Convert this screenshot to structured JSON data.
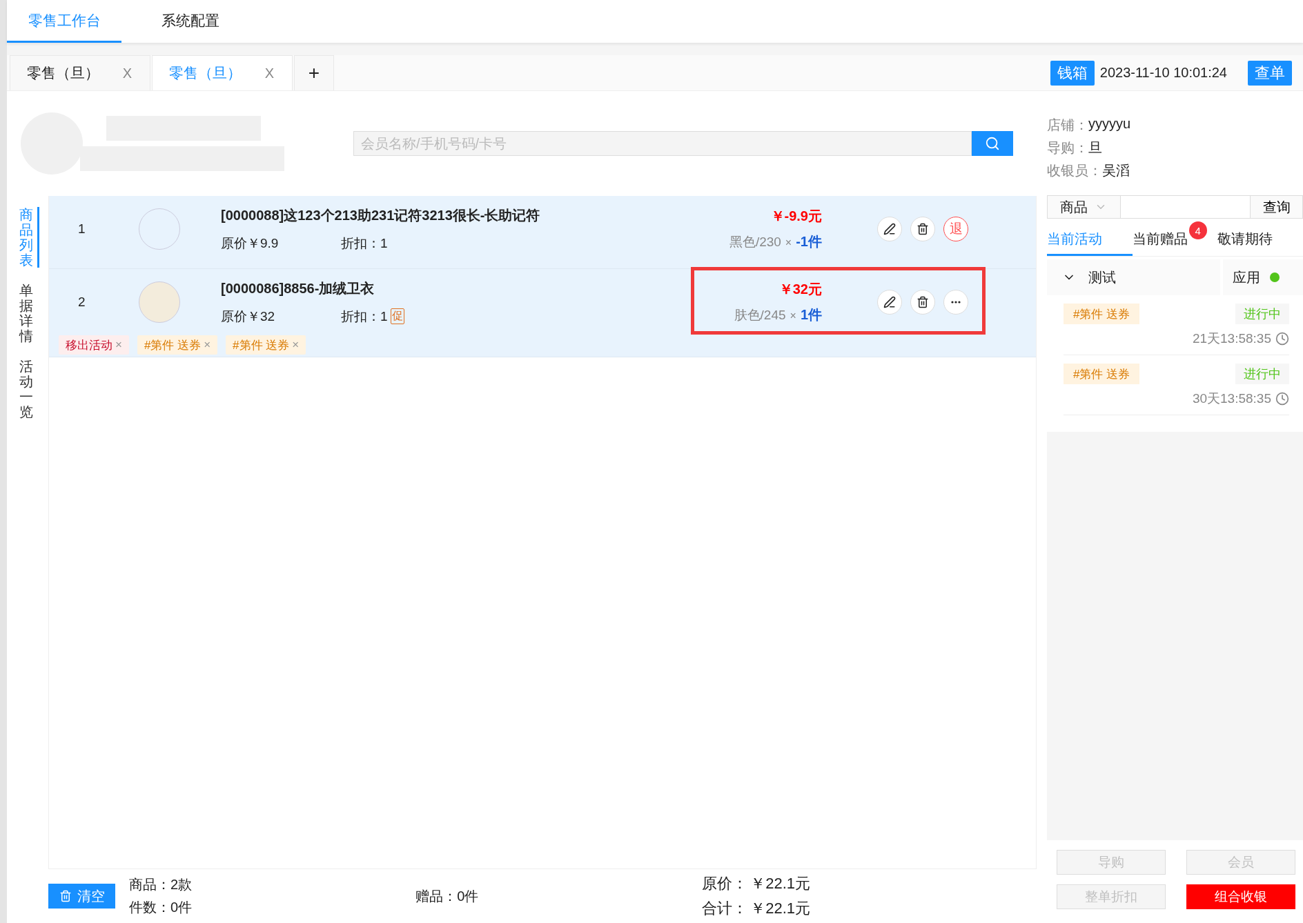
{
  "top_tabs": [
    {
      "label": "零售工作台",
      "selected": true
    },
    {
      "label": "系统配置",
      "selected": false
    }
  ],
  "order_tabs": [
    {
      "label": "零售（旦）",
      "close": "X",
      "selected": false
    },
    {
      "label": "零售（旦）",
      "close": "X",
      "selected": true
    }
  ],
  "add_tab": "+",
  "cash_box_button": "钱箱",
  "datetime": "2023-11-10 10:01:24",
  "lookup_button": "查单",
  "member_search": {
    "placeholder": "会员名称/手机号码/卡号"
  },
  "store_info": [
    {
      "label": "店铺：",
      "value": "yyyyyu"
    },
    {
      "label": "导购：",
      "value": "旦"
    },
    {
      "label": "收银员：",
      "value": "吴滔"
    }
  ],
  "side_nav": [
    {
      "label": "商品列表",
      "selected": true
    },
    {
      "label": "单据详情",
      "selected": false
    },
    {
      "label": "活动一览",
      "selected": false
    }
  ],
  "items": [
    {
      "index": "1",
      "kind": "empty",
      "name": "[0000088]这123个213助231记符3213很长-长助记符",
      "original_price": "原价￥9.9",
      "discount": "折扣：1",
      "price": "￥-9.9元",
      "spec": "黑色/230",
      "times": "×",
      "quantity": "-1件",
      "highlighted": false,
      "actions": [
        {
          "kind": "edit"
        },
        {
          "kind": "delete"
        },
        {
          "kind": "return",
          "label": "退"
        }
      ]
    },
    {
      "index": "2",
      "kind": "photo",
      "name": "[0000086]8856-加绒卫衣",
      "original_price": "原价￥32",
      "discount": "折扣：1",
      "promo_mark": "促",
      "price": "￥32元",
      "spec": "肤色/245",
      "times": "×",
      "quantity": "1件",
      "highlighted": true,
      "actions": [
        {
          "kind": "edit"
        },
        {
          "kind": "delete"
        },
        {
          "kind": "more"
        }
      ],
      "tags": [
        {
          "kind": "remove",
          "label": "移出活动",
          "close": "×"
        },
        {
          "kind": "promo",
          "label": "#第件 送券",
          "close": "×"
        },
        {
          "kind": "promo",
          "label": "#第件 送券",
          "close": "×"
        }
      ]
    }
  ],
  "footer": {
    "clear_button": "清空",
    "goods_count": "商品：2款",
    "piece_count": "件数：0件",
    "gift_count": "赠品：0件",
    "original_label": "原价：",
    "original_total": "￥22.1元",
    "total_label": "合计：",
    "total": "￥22.1元"
  },
  "panel_search": {
    "category": "商品",
    "button": "查询"
  },
  "panel_tabs": [
    {
      "label": "当前活动",
      "selected": true
    },
    {
      "label": "当前赠品",
      "badge": "4",
      "selected": false
    },
    {
      "label": "敬请期待",
      "selected": false
    }
  ],
  "activity_group": {
    "title": "测试",
    "expanded": true,
    "action": "应用"
  },
  "activities": [
    {
      "tag": "#第件 送券",
      "status": "进行中",
      "countdown": "21天13:58:35"
    },
    {
      "tag": "#第件 送券",
      "status": "进行中",
      "countdown": "30天13:58:35"
    }
  ],
  "panel_buttons": [
    {
      "label": "导购",
      "disabled": true
    },
    {
      "label": "会员",
      "disabled": true
    },
    {
      "label": "整单折扣",
      "disabled": true
    },
    {
      "label": "组合收银",
      "disabled": false
    }
  ]
}
